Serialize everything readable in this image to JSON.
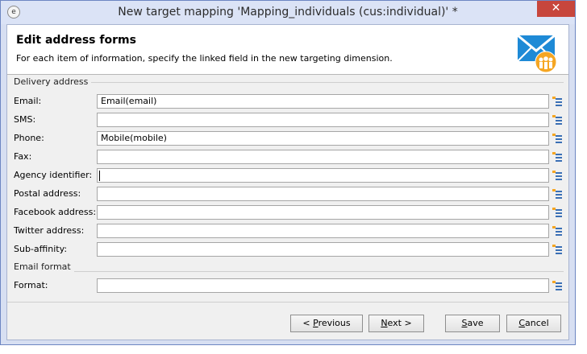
{
  "window": {
    "title": "New target mapping 'Mapping_individuals (cus:individual)' *",
    "close_glyph": "✕"
  },
  "header": {
    "title": "Edit address forms",
    "description": "For each item of information, specify the linked field in the new targeting dimension.",
    "icon": "envelope-people-icon"
  },
  "sections": {
    "delivery": "Delivery address",
    "email_format": "Email format"
  },
  "fields": [
    {
      "label": "Email:",
      "value": "Email(email)"
    },
    {
      "label": "SMS:",
      "value": ""
    },
    {
      "label": "Phone:",
      "value": "Mobile(mobile)"
    },
    {
      "label": "Fax:",
      "value": ""
    },
    {
      "label": "Agency identifier:",
      "value": ""
    },
    {
      "label": "Postal address:",
      "value": ""
    },
    {
      "label": "Facebook address:",
      "value": ""
    },
    {
      "label": "Twitter address:",
      "value": ""
    },
    {
      "label": "Sub-affinity:",
      "value": ""
    }
  ],
  "format_field": {
    "label": "Format:",
    "value": ""
  },
  "buttons": {
    "previous_prefix": "< ",
    "previous_key": "P",
    "previous_rest": "revious",
    "next_key": "N",
    "next_rest": "ext >",
    "save_key": "S",
    "save_rest": "ave",
    "cancel_key": "C",
    "cancel_rest": "ancel"
  },
  "colors": {
    "accent_blue": "#1e8ad6",
    "accent_orange": "#f5a623",
    "close_red": "#c7463c"
  }
}
